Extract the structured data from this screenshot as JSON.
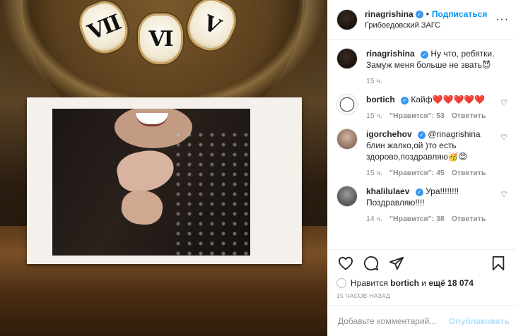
{
  "header": {
    "username": "rinagrishina",
    "dot": "•",
    "follow_label": "Подписаться",
    "location": "Грибоедовский ЗАГС",
    "more_label": "···"
  },
  "photo": {
    "numerals": [
      "VII",
      "VI",
      "V"
    ]
  },
  "caption": {
    "username": "rinagrishina",
    "text": "Ну что, ребятки. Замуж меня больше не звать😈",
    "time": "15 ч."
  },
  "comments": [
    {
      "username": "bortich",
      "text": "Кайф❤️❤️❤️❤️❤️",
      "time": "15 ч.",
      "likes": "\"Нравится\": 53",
      "reply": "Ответить"
    },
    {
      "username": "igorchehov",
      "text": "@rinagrishina блин жалко,ой )то есть здорово,поздравляю🥳😍",
      "time": "15 ч.",
      "likes": "\"Нравится\": 45",
      "reply": "Ответить"
    },
    {
      "username": "khalilulaev",
      "text": "Ура!!!!!!!! Поздравляю!!!!",
      "time": "14 ч.",
      "likes": "\"Нравится\": 38",
      "reply": "Ответить"
    }
  ],
  "likes": {
    "prefix": "Нравится",
    "user": "bortich",
    "middle": "и",
    "count": "ещё 18 074"
  },
  "timestamp": "15 ЧАСОВ НАЗАД",
  "add_comment": {
    "placeholder": "Добавьте комментарий...",
    "publish_label": "Опубликовать"
  },
  "icons": {
    "like": "heart-icon",
    "comment": "comment-icon",
    "share": "share-icon",
    "save": "bookmark-icon"
  },
  "colors": {
    "accent": "#0095f6",
    "verified": "#3897f0",
    "publish_disabled": "#b2dffc"
  }
}
